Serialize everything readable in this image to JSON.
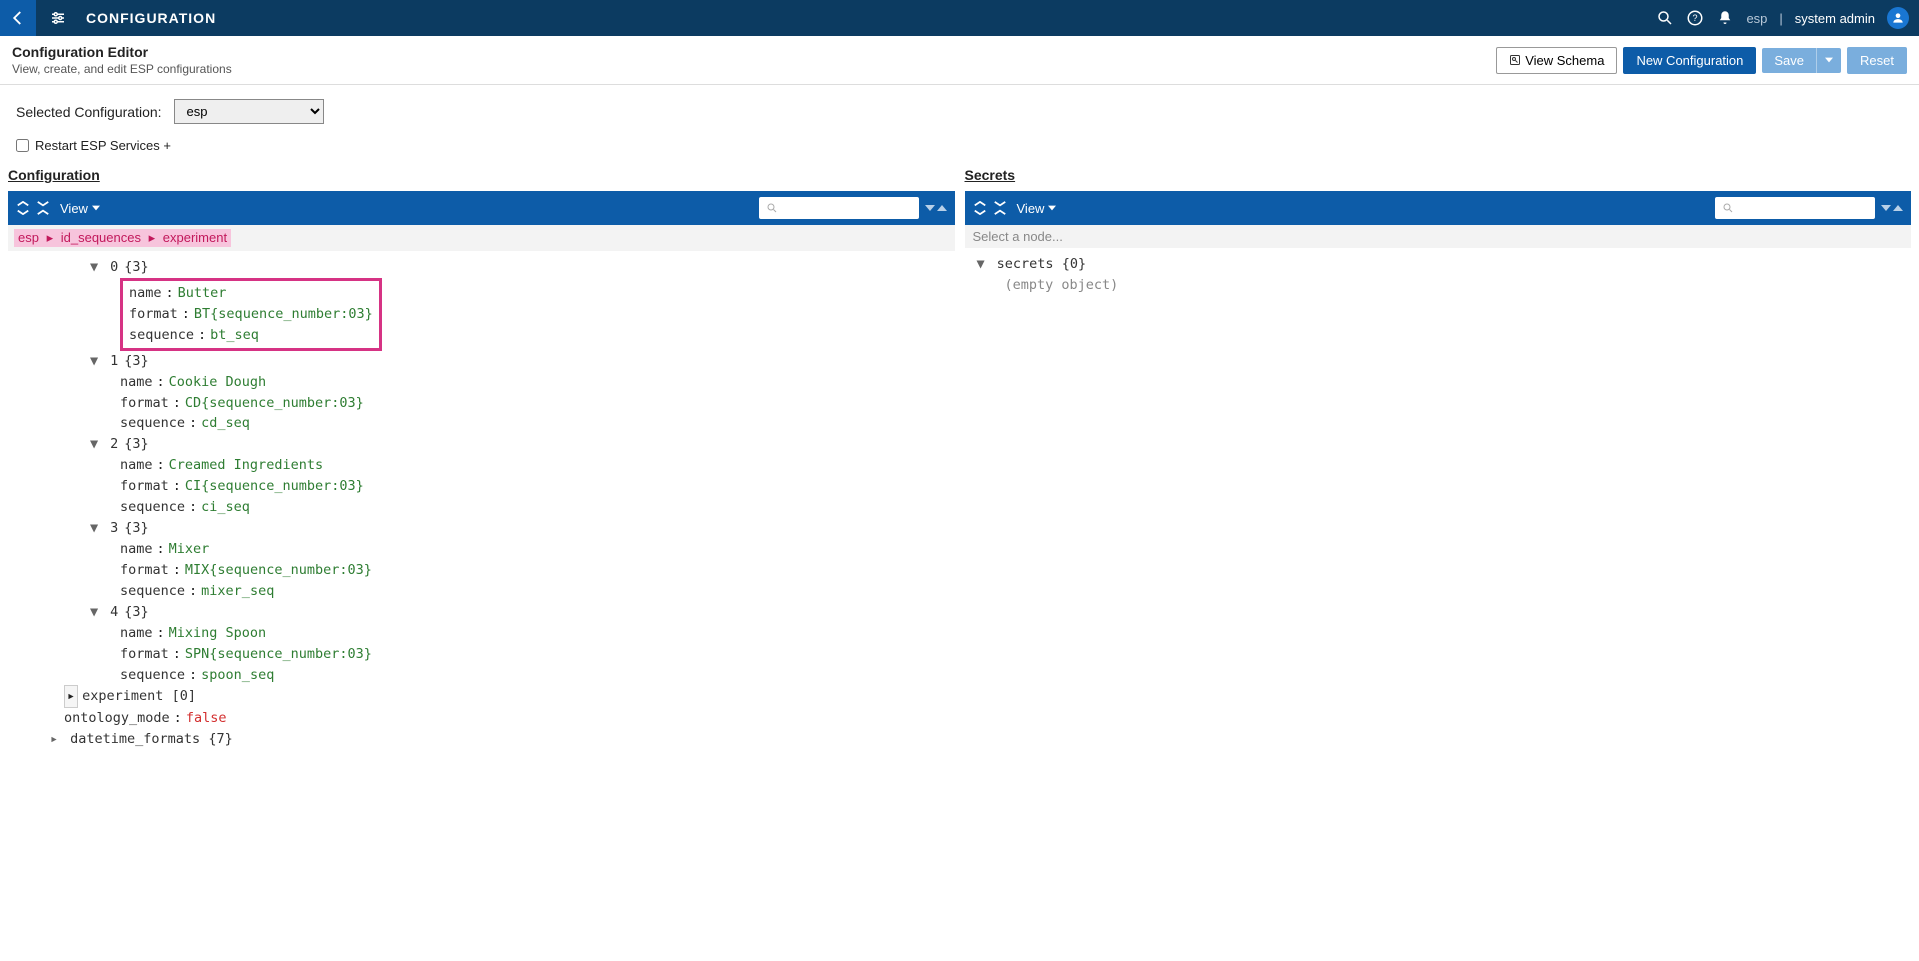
{
  "topbar": {
    "title": "CONFIGURATION",
    "tenant": "esp",
    "user": "system admin",
    "divider": "|"
  },
  "subheader": {
    "title": "Configuration Editor",
    "subtitle": "View, create, and edit ESP configurations",
    "view_schema": "View Schema",
    "new_config": "New Configuration",
    "save": "Save",
    "reset": "Reset"
  },
  "controls": {
    "selected_label": "Selected Configuration:",
    "selected_value": "esp",
    "restart_label": "Restart ESP Services +"
  },
  "panels": {
    "config_title": "Configuration",
    "secrets_title": "Secrets",
    "view_label": "View",
    "select_node": "Select a node..."
  },
  "breadcrumb": {
    "p0": "esp",
    "p1": "id_sequences",
    "p2": "experiment",
    "sep": "▸"
  },
  "tree": {
    "items": [
      {
        "idx": "0",
        "count": "{3}",
        "name": "Butter",
        "format": "BT{sequence_number:03}",
        "sequence": "bt_seq"
      },
      {
        "idx": "1",
        "count": "{3}",
        "name": "Cookie Dough",
        "format": "CD{sequence_number:03}",
        "sequence": "cd_seq"
      },
      {
        "idx": "2",
        "count": "{3}",
        "name": "Creamed Ingredients",
        "format": "CI{sequence_number:03}",
        "sequence": "ci_seq"
      },
      {
        "idx": "3",
        "count": "{3}",
        "name": "Mixer",
        "format": "MIX{sequence_number:03}",
        "sequence": "mixer_seq"
      },
      {
        "idx": "4",
        "count": "{3}",
        "name": "Mixing Spoon",
        "format": "SPN{sequence_number:03}",
        "sequence": "spoon_seq"
      }
    ],
    "labels": {
      "name": "name",
      "format": "format",
      "sequence": "sequence"
    },
    "experiment_key": "experiment",
    "experiment_count": "[0]",
    "ontology_key": "ontology_mode",
    "ontology_val": "false",
    "datetime_key": "datetime_formats",
    "datetime_count": "{7}"
  },
  "secrets": {
    "root_key": "secrets",
    "root_count": "{0}",
    "empty": "(empty object)"
  }
}
